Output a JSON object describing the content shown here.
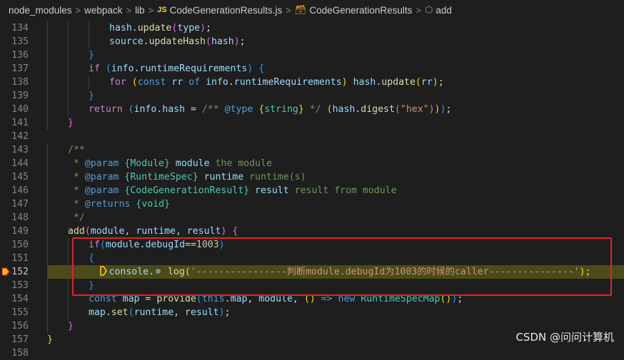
{
  "breadcrumb": {
    "items": [
      "node_modules",
      "webpack",
      "lib"
    ],
    "file_badge": "JS",
    "file": "CodeGenerationResults.js",
    "class_name": "CodeGenerationResults",
    "method_name": "add",
    "separator": ">"
  },
  "editor": {
    "current_line": 152,
    "lines": [
      {
        "n": 134,
        "tokens": [
          [
            "t-var",
            "hash"
          ],
          [
            "",
            "."
          ],
          [
            "t-fn",
            "update"
          ],
          [
            "t-b2",
            "("
          ],
          [
            "t-var",
            "type"
          ],
          [
            "t-b2",
            ")"
          ],
          [
            "",
            ";"
          ]
        ]
      },
      {
        "n": 135,
        "tokens": [
          [
            "t-var",
            "source"
          ],
          [
            "",
            "."
          ],
          [
            "t-fn",
            "updateHash"
          ],
          [
            "t-b2",
            "("
          ],
          [
            "t-var",
            "hash"
          ],
          [
            "t-b2",
            ")"
          ],
          [
            "",
            ";"
          ]
        ]
      },
      {
        "n": 136,
        "tokens": [
          [
            "t-b3",
            "}"
          ]
        ]
      },
      {
        "n": 137,
        "tokens": [
          [
            "t-kw",
            "if"
          ],
          [
            "",
            " "
          ],
          [
            "t-b3",
            "("
          ],
          [
            "t-var",
            "info"
          ],
          [
            "",
            "."
          ],
          [
            "t-var",
            "runtimeRequirements"
          ],
          [
            "t-b3",
            ")"
          ],
          [
            "",
            " "
          ],
          [
            "t-b3",
            "{"
          ]
        ]
      },
      {
        "n": 138,
        "tokens": [
          [
            "t-kw",
            "for"
          ],
          [
            "",
            " "
          ],
          [
            "t-b1",
            "("
          ],
          [
            "t-dec",
            "const"
          ],
          [
            "",
            " "
          ],
          [
            "t-var",
            "rr"
          ],
          [
            "",
            " "
          ],
          [
            "t-dec",
            "of"
          ],
          [
            "",
            " "
          ],
          [
            "t-var",
            "info"
          ],
          [
            "",
            "."
          ],
          [
            "t-var",
            "runtimeRequirements"
          ],
          [
            "t-b1",
            ")"
          ],
          [
            "",
            " "
          ],
          [
            "t-var",
            "hash"
          ],
          [
            "",
            "."
          ],
          [
            "t-fn",
            "update"
          ],
          [
            "t-b1",
            "("
          ],
          [
            "t-var",
            "rr"
          ],
          [
            "t-b1",
            ")"
          ],
          [
            "",
            ";"
          ]
        ]
      },
      {
        "n": 139,
        "tokens": [
          [
            "t-b3",
            "}"
          ]
        ]
      },
      {
        "n": 140,
        "tokens": [
          [
            "t-kw",
            "return"
          ],
          [
            "",
            " "
          ],
          [
            "t-b3",
            "("
          ],
          [
            "t-var",
            "info"
          ],
          [
            "",
            "."
          ],
          [
            "t-var",
            "hash"
          ],
          [
            "",
            " = "
          ],
          [
            "t-cm",
            "/** "
          ],
          [
            "t-dec",
            "@type"
          ],
          [
            "",
            " "
          ],
          [
            "t-b1",
            "{"
          ],
          [
            "t-type",
            "string"
          ],
          [
            "t-b1",
            "}"
          ],
          [
            "t-cm",
            " */"
          ],
          [
            "",
            " "
          ],
          [
            "t-b1",
            "("
          ],
          [
            "t-var",
            "hash"
          ],
          [
            "",
            "."
          ],
          [
            "t-fn",
            "digest"
          ],
          [
            "t-b2",
            "("
          ],
          [
            "t-str",
            "\"hex\""
          ],
          [
            "t-b2",
            ")"
          ],
          [
            "t-b1",
            ")"
          ],
          [
            "t-b3",
            ")"
          ],
          [
            "",
            ";"
          ]
        ]
      },
      {
        "n": 141,
        "tokens": [
          [
            "t-b2",
            "}"
          ]
        ]
      },
      {
        "n": 142,
        "tokens": []
      },
      {
        "n": 143,
        "tokens": [
          [
            "t-cm",
            "/**"
          ]
        ]
      },
      {
        "n": 144,
        "tokens": [
          [
            "t-cm",
            " * "
          ],
          [
            "t-dec",
            "@param"
          ],
          [
            "t-cm",
            " "
          ],
          [
            "t-type",
            "{Module}"
          ],
          [
            "t-cm",
            " "
          ],
          [
            "t-var",
            "module"
          ],
          [
            "t-cm",
            " the module"
          ]
        ]
      },
      {
        "n": 145,
        "tokens": [
          [
            "t-cm",
            " * "
          ],
          [
            "t-dec",
            "@param"
          ],
          [
            "t-cm",
            " "
          ],
          [
            "t-type",
            "{RuntimeSpec}"
          ],
          [
            "t-cm",
            " "
          ],
          [
            "t-var",
            "runtime"
          ],
          [
            "t-cm",
            " runtime(s)"
          ]
        ]
      },
      {
        "n": 146,
        "tokens": [
          [
            "t-cm",
            " * "
          ],
          [
            "t-dec",
            "@param"
          ],
          [
            "t-cm",
            " "
          ],
          [
            "t-type",
            "{CodeGenerationResult}"
          ],
          [
            "t-cm",
            " "
          ],
          [
            "t-var",
            "result"
          ],
          [
            "t-cm",
            " result from module"
          ]
        ]
      },
      {
        "n": 147,
        "tokens": [
          [
            "t-cm",
            " * "
          ],
          [
            "t-dec",
            "@returns"
          ],
          [
            "t-cm",
            " "
          ],
          [
            "t-type",
            "{void}"
          ]
        ]
      },
      {
        "n": 148,
        "tokens": [
          [
            "t-cm",
            " */"
          ]
        ]
      },
      {
        "n": 149,
        "tokens": [
          [
            "t-fn",
            "add"
          ],
          [
            "t-b2",
            "("
          ],
          [
            "t-var",
            "module"
          ],
          [
            "",
            ", "
          ],
          [
            "t-var",
            "runtime"
          ],
          [
            "",
            ", "
          ],
          [
            "t-var",
            "result"
          ],
          [
            "t-b2",
            ")"
          ],
          [
            "",
            " "
          ],
          [
            "t-b2",
            "{"
          ]
        ]
      },
      {
        "n": 150,
        "tokens": [
          [
            "t-kw",
            "if"
          ],
          [
            "t-b3",
            "("
          ],
          [
            "t-var",
            "module"
          ],
          [
            "",
            "."
          ],
          [
            "t-var",
            "debugId"
          ],
          [
            "",
            "=="
          ],
          [
            "t-num",
            "1003"
          ],
          [
            "t-b3",
            ")"
          ]
        ]
      },
      {
        "n": 151,
        "tokens": [
          [
            "t-b3",
            "{"
          ]
        ]
      },
      {
        "n": 152,
        "tokens": [
          [
            "t-var",
            "console"
          ],
          [
            "",
            "."
          ],
          [
            "",
            " "
          ],
          [
            "t-fn",
            "log"
          ],
          [
            "t-b1",
            "("
          ],
          [
            "t-str",
            "'----------------判断module.debugId为1003的时候的caller---------------'"
          ],
          [
            "t-b1",
            ")"
          ],
          [
            "",
            ";"
          ]
        ]
      },
      {
        "n": 153,
        "tokens": [
          [
            "t-b3",
            "}"
          ]
        ]
      },
      {
        "n": 154,
        "tokens": [
          [
            "t-dec",
            "const"
          ],
          [
            "",
            " "
          ],
          [
            "t-var",
            "map"
          ],
          [
            "",
            " = "
          ],
          [
            "t-fn",
            "provide"
          ],
          [
            "t-b3",
            "("
          ],
          [
            "t-dec",
            "this"
          ],
          [
            "",
            "."
          ],
          [
            "t-var",
            "map"
          ],
          [
            "",
            ", "
          ],
          [
            "t-var",
            "module"
          ],
          [
            "",
            ", "
          ],
          [
            "t-b1",
            "("
          ],
          [
            "t-b1",
            ")"
          ],
          [
            "",
            " "
          ],
          [
            "t-dec",
            "=>"
          ],
          [
            "",
            " "
          ],
          [
            "t-dec",
            "new"
          ],
          [
            "",
            " "
          ],
          [
            "t-type",
            "RuntimeSpecMap"
          ],
          [
            "t-b1",
            "("
          ],
          [
            "t-b1",
            ")"
          ],
          [
            "t-b3",
            ")"
          ],
          [
            "",
            ";"
          ]
        ]
      },
      {
        "n": 155,
        "tokens": [
          [
            "t-var",
            "map"
          ],
          [
            "",
            "."
          ],
          [
            "t-fn",
            "set"
          ],
          [
            "t-b3",
            "("
          ],
          [
            "t-var",
            "runtime"
          ],
          [
            "",
            ", "
          ],
          [
            "t-var",
            "result"
          ],
          [
            "t-b3",
            ")"
          ],
          [
            "",
            ";"
          ]
        ]
      },
      {
        "n": 156,
        "tokens": [
          [
            "t-b2",
            "}"
          ]
        ]
      },
      {
        "n": 157,
        "tokens": [
          [
            "t-b1",
            "}"
          ]
        ]
      },
      {
        "n": 158,
        "tokens": []
      }
    ]
  },
  "watermark": "CSDN @问问计算机"
}
